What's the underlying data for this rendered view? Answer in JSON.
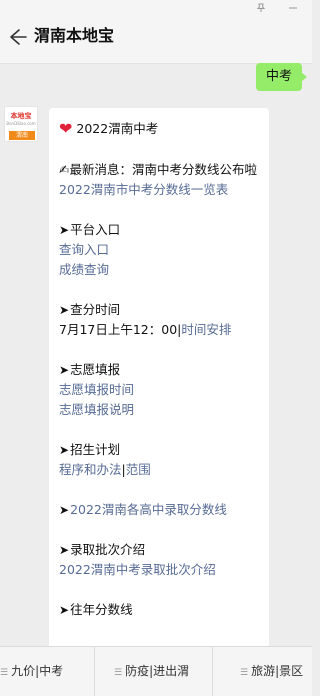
{
  "window": {
    "pin_icon": "pin-icon",
    "minimize_icon": "minimize-icon"
  },
  "header": {
    "back_icon": "back-arrow-icon",
    "title": "渭南本地宝"
  },
  "chat": {
    "sent_message": "中考",
    "avatar": {
      "logo_text": "本地宝",
      "logo_sub": "BenDiBao.com",
      "city_tag": "渭南"
    },
    "reply": {
      "heart_icon": "heart-icon",
      "heading": "2022渭南中考",
      "news_prefix": "✍最新消息：渭南中考分数线公布啦",
      "news_link": "2022渭南市中考分数线一览表",
      "arrow_glyph": "➤",
      "platform_heading": "平台入口",
      "platform_link_1": "查询入口",
      "platform_link_2": "成绩查询",
      "score_time_heading": "查分时间",
      "score_time_text": "7月17日上午12：00|",
      "score_time_link": "时间安排",
      "volunteer_heading": "志愿填报",
      "volunteer_link_1": "志愿填报时间",
      "volunteer_link_2": "志愿填报说明",
      "enroll_heading": "招生计划",
      "enroll_link_1": "程序和办法",
      "enroll_sep": "|",
      "enroll_link_2": "范围",
      "admission_link": "2022渭南各高中录取分数线",
      "batch_heading": "录取批次介绍",
      "batch_link": "2022渭南中考录取批次介绍",
      "past_heading": "往年分数线"
    }
  },
  "bottom_menu": {
    "menu_icon": "menu-lines-icon",
    "items": [
      "九价|中考",
      "防疫|进出渭",
      "旅游|景区"
    ]
  }
}
